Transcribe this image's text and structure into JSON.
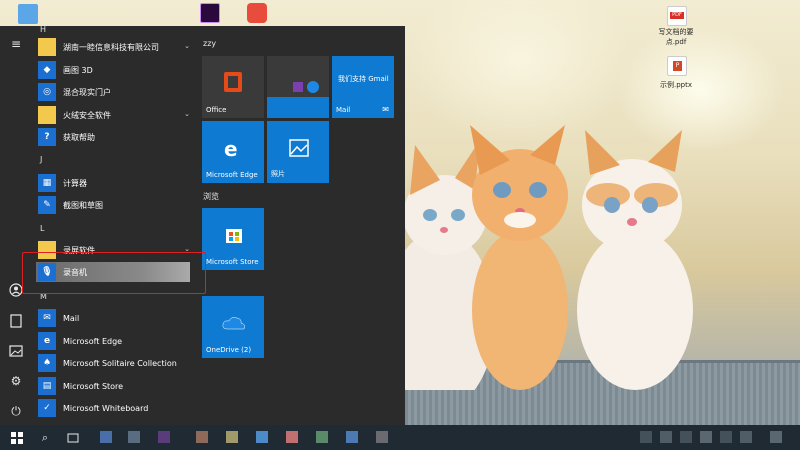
{
  "desktop": {
    "files": [
      {
        "name": "pdf-file",
        "label": "写文档的要\n点.pdf",
        "badge": "PDF"
      },
      {
        "name": "pptx-file",
        "label": "示例.pptx",
        "badge": "P"
      }
    ]
  },
  "start_menu": {
    "letters": {
      "h": "H",
      "j": "J",
      "l": "L",
      "m": "M"
    },
    "apps": [
      {
        "label": "湖南一睦信息科技有限公司",
        "color": "#f2c94c"
      },
      {
        "label": "画图 3D",
        "color": "#1b6fd1"
      },
      {
        "label": "混合现实门户",
        "color": "#1b6fd1"
      },
      {
        "label": "火绒安全软件",
        "color": "#f2c94c"
      },
      {
        "label": "获取帮助",
        "color": "#1b6fd1"
      },
      {
        "label": "计算器",
        "color": "#1b6fd1"
      },
      {
        "label": "截图和草图",
        "color": "#1b6fd1"
      },
      {
        "label": "录屏软件",
        "color": "#f2c94c"
      },
      {
        "label": "录音机",
        "color": "#1b6fd1"
      },
      {
        "label": "Mail",
        "color": "#1b6fd1"
      },
      {
        "label": "Microsoft Edge",
        "color": "#1b6fd1"
      },
      {
        "label": "Microsoft Solitaire Collection",
        "color": "#1b6fd1"
      },
      {
        "label": "Microsoft Store",
        "color": "#1b6fd1"
      },
      {
        "label": "Microsoft Whiteboard",
        "color": "#1b6fd1"
      }
    ],
    "tiles": {
      "group1": "zzy",
      "group2": "浏览",
      "office": "Office",
      "mail_promo": "我们支持 Gmail",
      "mail": "Mail",
      "edge": "Microsoft Edge",
      "photos": "照片",
      "store": "Microsoft Store",
      "onedrive": "OneDrive (2)"
    }
  },
  "taskbar": {
    "start_icon": "windows-icon",
    "search_icon": "search-icon",
    "taskview_icon": "task-view-icon"
  },
  "colors": {
    "tile_blue": "#0f7ad1",
    "menu_bg": "#2b2b2b",
    "highlight_red": "#e02020"
  }
}
